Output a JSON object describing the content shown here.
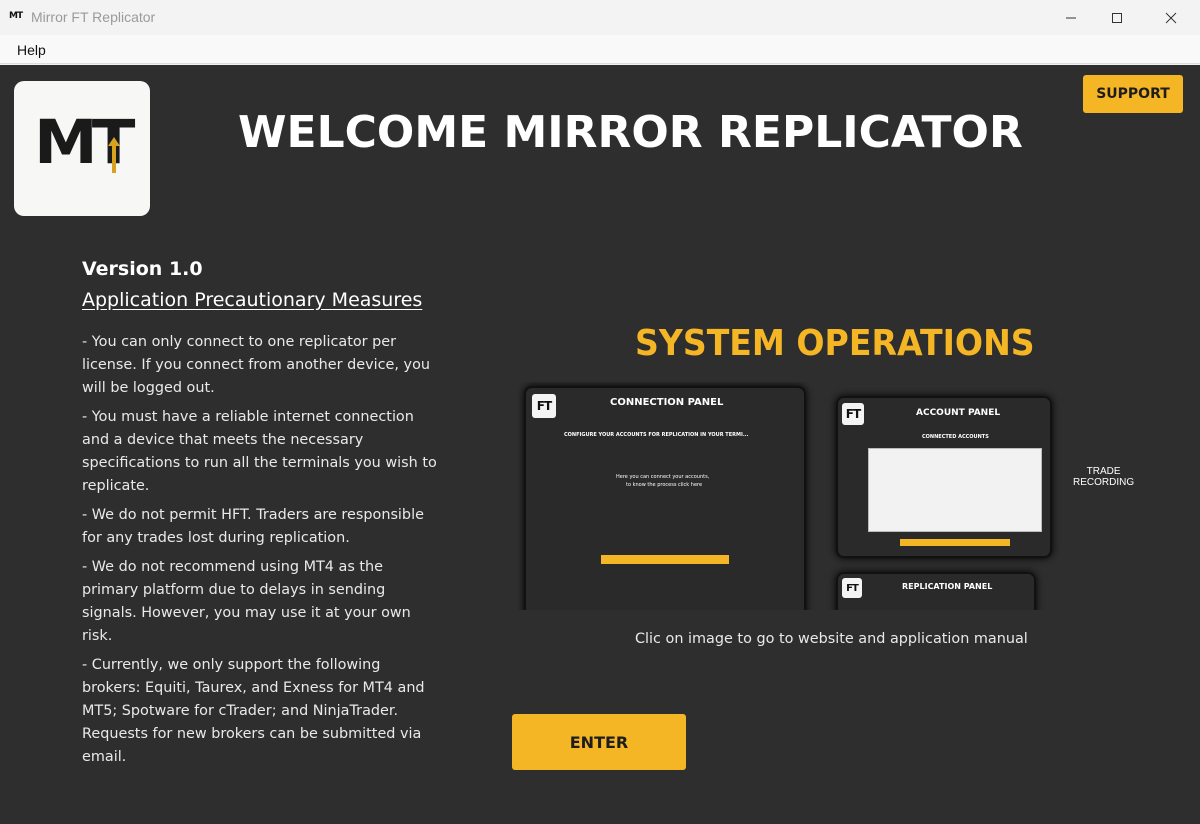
{
  "window": {
    "icon_text": "MT",
    "title": "Mirror FT Replicator",
    "controls": [
      "minimize-icon",
      "maximize-icon",
      "close-icon"
    ]
  },
  "menu": {
    "items": [
      "Help"
    ]
  },
  "header": {
    "logo_text": "MT",
    "welcome": "WELCOME MIRROR REPLICATOR",
    "support_label": "SUPPORT"
  },
  "info": {
    "version": "Version 1.0",
    "precautions_title": "Application Precautionary Measures",
    "rules": [
      "- You can only connect to one replicator per license. If you connect from another device, you will be logged out.",
      "- You must have a reliable internet connection and a device that meets the necessary specifications to run all the terminals you wish to replicate.",
      "- We do not permit HFT. Traders are responsible for any trades lost during replication.",
      "- We do not recommend using MT4 as the primary platform due to delays in sending signals. However, you may use it at your own risk.",
      "- Currently, we only support the following brokers: Equiti, Taurex, and Exness for MT4 and MT5; Spotware for cTrader; and NinjaTrader. Requests for new brokers can be submitted via email."
    ]
  },
  "operations": {
    "title": "SYSTEM OPERATIONS",
    "preview": {
      "panel_logo": "FT",
      "connection_panel": "CONNECTION PANEL",
      "configure_text": "CONFIGURE YOUR ACCOUNTS FOR REPLICATION IN YOUR TERMI...",
      "connect_line1": "Here you can connect your accounts,",
      "connect_line2": "to know the process click here",
      "account_panel": "ACCOUNT PANEL",
      "connected_accounts": "CONNECTED ACCOUNTS",
      "trade_recording_1": "TRADE",
      "trade_recording_2": "RECORDING",
      "replication_panel": "REPLICATION PANEL"
    },
    "caption": "Clic on image to go to website and application manual"
  },
  "footer": {
    "enter_label": "ENTER"
  },
  "colors": {
    "accent": "#f5b626",
    "background": "#2e2e2e",
    "text": "#ffffff"
  }
}
